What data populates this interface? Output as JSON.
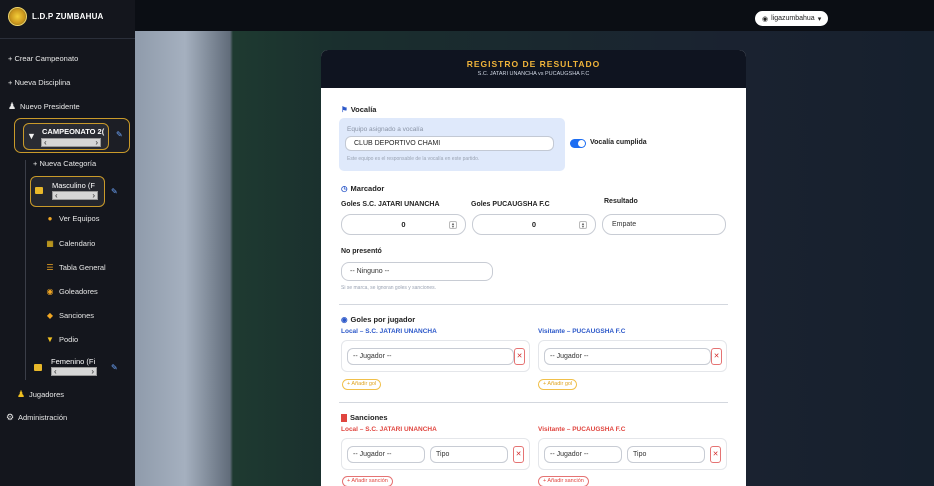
{
  "brand": {
    "name": "L.D.P ZUMBAHUA"
  },
  "user": {
    "name": "ligazumbahua"
  },
  "sidebar": {
    "create_championship": "+ Crear Campeonato",
    "new_discipline": "+ Nueva Disciplina",
    "new_president": "Nuevo Presidente",
    "championship_label": "CAMPEONATO 2(",
    "new_category": "+ Nueva Categoría",
    "category_male": "Masculino (F ",
    "items": [
      {
        "label": "Ver Equipos",
        "icon": "teams-icon"
      },
      {
        "label": "Calendario",
        "icon": "calendar-icon"
      },
      {
        "label": "Tabla General",
        "icon": "table-icon"
      },
      {
        "label": "Goleadores",
        "icon": "ball-icon"
      },
      {
        "label": "Sanciones",
        "icon": "card-icon"
      },
      {
        "label": "Podio",
        "icon": "trophy-icon"
      }
    ],
    "category_female": "Femenino (Fi",
    "players": "Jugadores",
    "admin": "Administración"
  },
  "card": {
    "title": "REGISTRO DE RESULTADO",
    "subtitle": "S.C. JATARI UNANCHA vs PUCAUGSHA F.C"
  },
  "vocalia": {
    "title": "Vocalía",
    "label": "Equipo asignado a vocalía",
    "value": "CLUB DEPORTIVO CHAMI",
    "help": "Este equipo es el responsable de la vocalía en este partido.",
    "toggle_label": "Vocalía cumplida"
  },
  "score": {
    "title": "Marcador",
    "home_label": "Goles S.C. JATARI UNANCHA",
    "home_value": "0",
    "away_label": "Goles PUCAUGSHA F.C",
    "away_value": "0",
    "result_label": "Resultado",
    "result_value": "Empate"
  },
  "no_show": {
    "title": "No presentó",
    "value": "-- Ninguno --",
    "hint": "Si se marca, se ignoran goles y sanciones."
  },
  "goals": {
    "title": "Goles por jugador",
    "home_team": "Local – S.C. JATARI UNANCHA",
    "away_team": "Visitante – PUCAUGSHA F.C",
    "player_placeholder": "-- Jugador --",
    "add_goal": "+ Añadir gol"
  },
  "sanctions": {
    "title": "Sanciones",
    "home_team": "Local – S.C. JATARI UNANCHA",
    "away_team": "Visitante – PUCAUGSHA F.C",
    "player_placeholder": "-- Jugador --",
    "type_placeholder": "Tipo",
    "add_sanction": "+ Añadir sanción"
  },
  "colors": {
    "accent": "#f0b43a",
    "primary": "#1c6df2",
    "danger": "#e0453f",
    "sidebar": "#14161d"
  }
}
